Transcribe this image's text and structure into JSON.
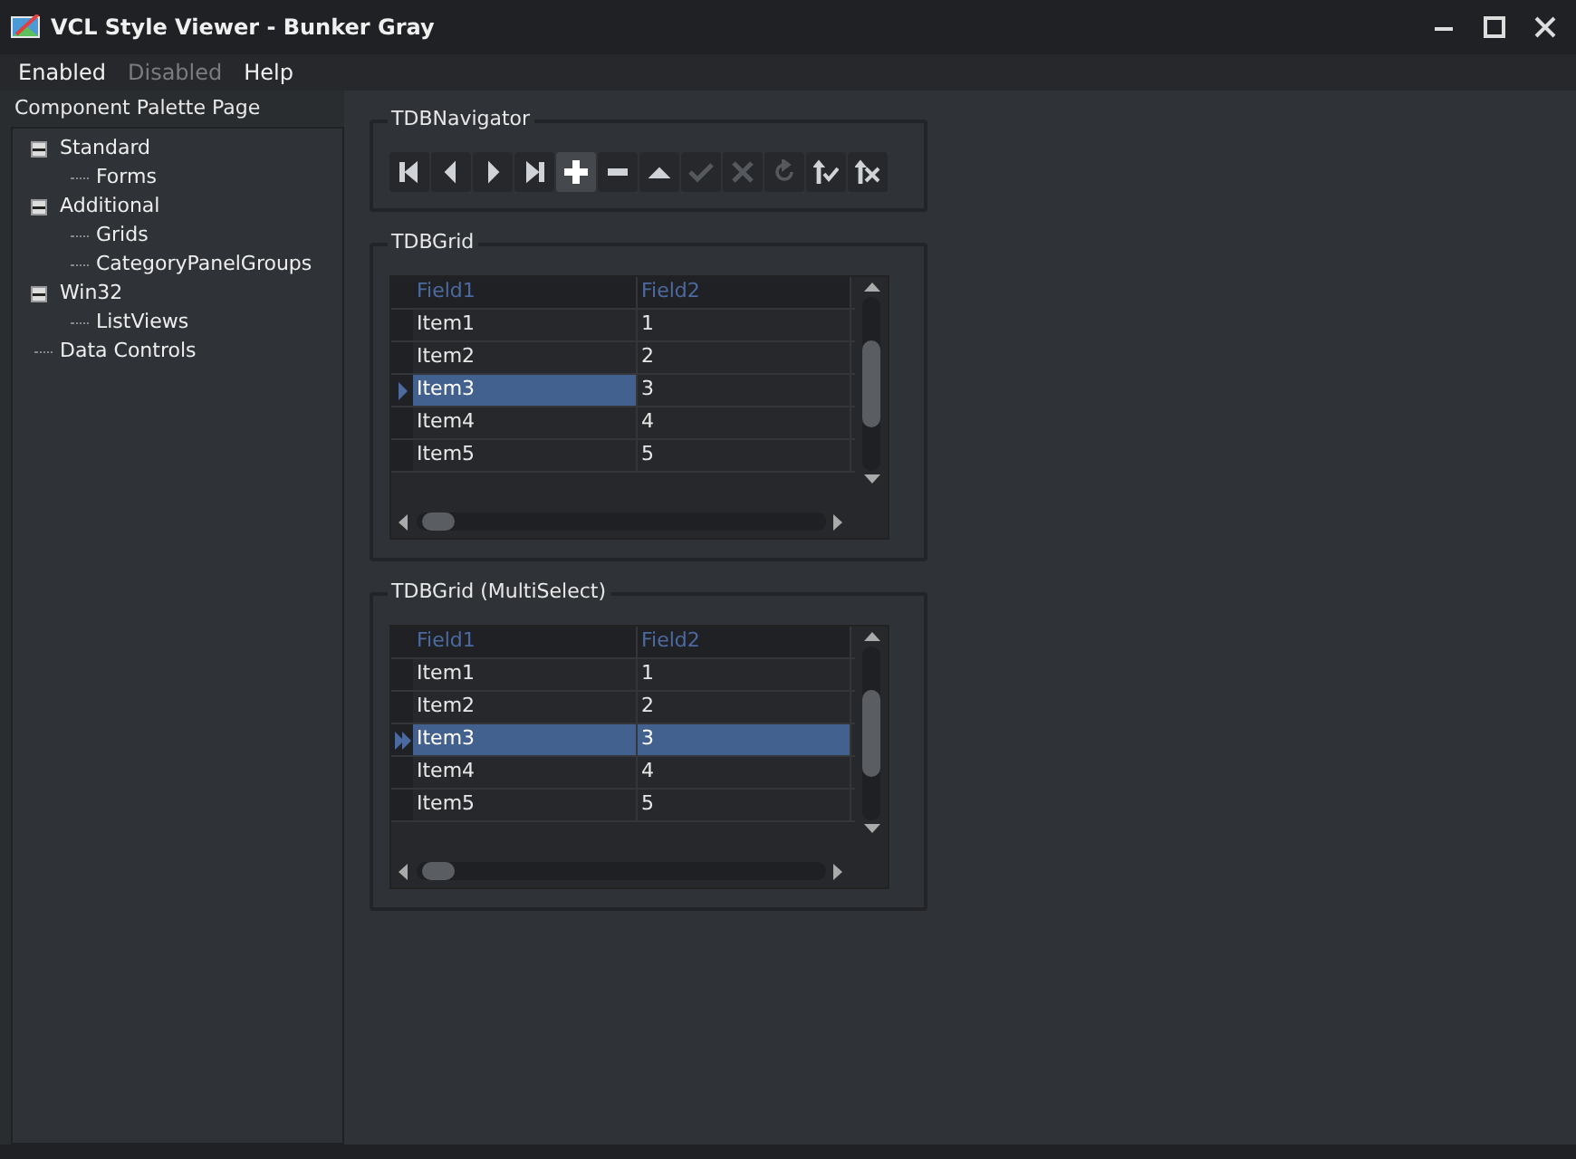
{
  "window": {
    "title": "VCL Style Viewer - Bunker Gray"
  },
  "menu": [
    {
      "label": "Enabled",
      "disabled": false
    },
    {
      "label": "Disabled",
      "disabled": true
    },
    {
      "label": "Help",
      "disabled": false
    }
  ],
  "sidebar": {
    "title": "Component Palette Page",
    "tree": [
      {
        "label": "Standard",
        "expanded": true,
        "children": [
          {
            "label": "Forms"
          }
        ]
      },
      {
        "label": "Additional",
        "expanded": true,
        "children": [
          {
            "label": "Grids"
          },
          {
            "label": "CategoryPanelGroups"
          }
        ]
      },
      {
        "label": "Win32",
        "expanded": true,
        "children": [
          {
            "label": "ListViews"
          }
        ]
      },
      {
        "label": "Data Controls"
      }
    ]
  },
  "navigator": {
    "title": "TDBNavigator",
    "buttons": [
      {
        "kind": "first",
        "disabled": false,
        "focused": false
      },
      {
        "kind": "prior",
        "disabled": false,
        "focused": false
      },
      {
        "kind": "next",
        "disabled": false,
        "focused": false
      },
      {
        "kind": "last",
        "disabled": false,
        "focused": false
      },
      {
        "kind": "insert",
        "disabled": false,
        "focused": true
      },
      {
        "kind": "delete",
        "disabled": false,
        "focused": false
      },
      {
        "kind": "edit",
        "disabled": false,
        "focused": false
      },
      {
        "kind": "post",
        "disabled": true,
        "focused": false
      },
      {
        "kind": "cancel",
        "disabled": true,
        "focused": false
      },
      {
        "kind": "refresh",
        "disabled": true,
        "focused": false
      },
      {
        "kind": "apply",
        "disabled": false,
        "focused": false
      },
      {
        "kind": "cancelupdates",
        "disabled": false,
        "focused": false
      }
    ]
  },
  "grids": [
    {
      "title": "TDBGrid",
      "multiselect": false,
      "columns": [
        "Field1",
        "Field2"
      ],
      "rows": [
        {
          "current": false,
          "cells": [
            {
              "text": "Item1",
              "selected": false
            },
            {
              "text": "1",
              "selected": false
            }
          ]
        },
        {
          "current": false,
          "cells": [
            {
              "text": "Item2",
              "selected": false
            },
            {
              "text": "2",
              "selected": false
            }
          ]
        },
        {
          "current": true,
          "cells": [
            {
              "text": "Item3",
              "selected": true
            },
            {
              "text": "3",
              "selected": false
            }
          ]
        },
        {
          "current": false,
          "cells": [
            {
              "text": "Item4",
              "selected": false
            },
            {
              "text": "4",
              "selected": false
            }
          ]
        },
        {
          "current": false,
          "cells": [
            {
              "text": "Item5",
              "selected": false
            },
            {
              "text": "5",
              "selected": false
            }
          ]
        }
      ]
    },
    {
      "title": "TDBGrid (MultiSelect)",
      "multiselect": true,
      "columns": [
        "Field1",
        "Field2"
      ],
      "rows": [
        {
          "current": false,
          "cells": [
            {
              "text": "Item1",
              "selected": false
            },
            {
              "text": "1",
              "selected": false
            }
          ]
        },
        {
          "current": false,
          "cells": [
            {
              "text": "Item2",
              "selected": false
            },
            {
              "text": "2",
              "selected": false
            }
          ]
        },
        {
          "current": true,
          "cells": [
            {
              "text": "Item3",
              "selected": true
            },
            {
              "text": "3",
              "selected": true
            }
          ]
        },
        {
          "current": false,
          "cells": [
            {
              "text": "Item4",
              "selected": false
            },
            {
              "text": "4",
              "selected": false
            }
          ]
        },
        {
          "current": false,
          "cells": [
            {
              "text": "Item5",
              "selected": false
            },
            {
              "text": "5",
              "selected": false
            }
          ]
        }
      ]
    }
  ]
}
